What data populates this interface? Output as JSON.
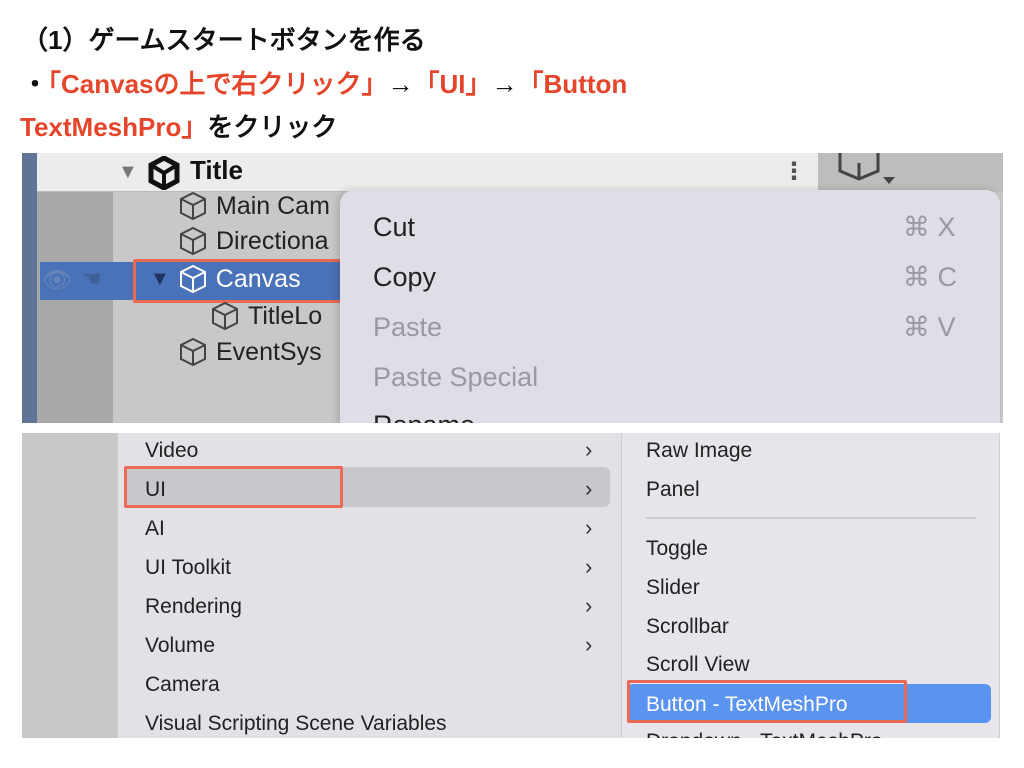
{
  "heading": {
    "line1": "（1）ゲームスタートボタンを作る",
    "bullet": "・",
    "step1": "「Canvasの上で右クリック」",
    "arrow1": "→",
    "step2": "「UI」",
    "arrow2": "→",
    "step3a": "「Button",
    "step3b": "TextMeshPro」",
    "suffix": "をクリック"
  },
  "colors": {
    "accent_red": "#e5452b",
    "selection_blue": "#4a72b8",
    "highlight_blue": "#5b94f0",
    "highlight_box": "#ea6a55"
  },
  "hierarchy": {
    "scene": "Title",
    "items": [
      {
        "label": "Main Cam",
        "icon": "cube-icon"
      },
      {
        "label": "Directiona",
        "icon": "cube-icon"
      },
      {
        "label": "Canvas",
        "icon": "cube-icon",
        "selected": true
      },
      {
        "label": "TitleLo",
        "icon": "cube-icon"
      },
      {
        "label": "EventSys",
        "icon": "cube-icon"
      }
    ]
  },
  "context_menu": {
    "items": [
      {
        "label": "Cut",
        "shortcut": "⌘ X",
        "enabled": true
      },
      {
        "label": "Copy",
        "shortcut": "⌘ C",
        "enabled": true
      },
      {
        "label": "Paste",
        "shortcut": "⌘ V",
        "enabled": false
      },
      {
        "label": "Paste Special",
        "shortcut": "",
        "enabled": false
      },
      {
        "label": "Rename",
        "shortcut": "",
        "enabled": true
      }
    ]
  },
  "create_menu": {
    "items": [
      {
        "label": "Video",
        "submenu": true
      },
      {
        "label": "UI",
        "submenu": true,
        "highlighted": true
      },
      {
        "label": "AI",
        "submenu": true
      },
      {
        "label": "UI Toolkit",
        "submenu": true
      },
      {
        "label": "Rendering",
        "submenu": true
      },
      {
        "label": "Volume",
        "submenu": true
      },
      {
        "label": "Camera",
        "submenu": false
      },
      {
        "label": "Visual Scripting Scene Variables",
        "submenu": false
      }
    ],
    "chevron": "›"
  },
  "ui_submenu": {
    "items": [
      "Raw Image",
      "Panel",
      "Toggle",
      "Slider",
      "Scrollbar",
      "Scroll View",
      "Button - TextMeshPro",
      "Dropdown - TextMeshPro"
    ]
  }
}
